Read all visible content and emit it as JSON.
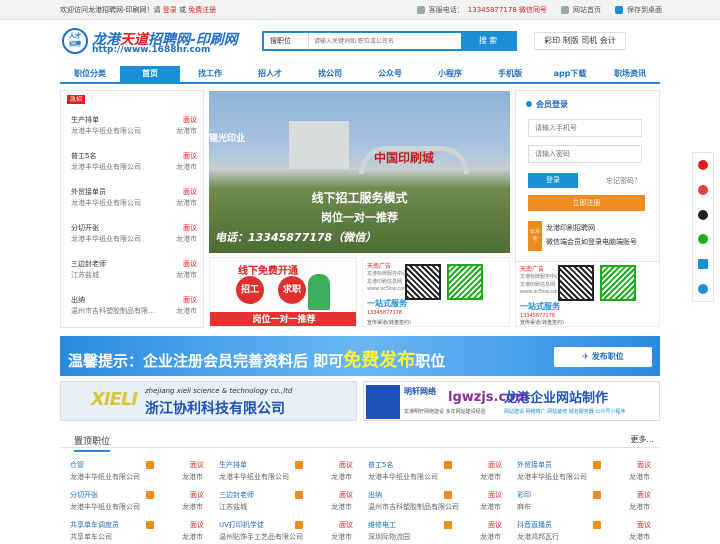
{
  "topbar": {
    "welcome": "欢迎访问龙港招聘网-印刷网！请",
    "login": "登录",
    "or": "或",
    "register": "免费注册",
    "phone_label": "客服电话：",
    "phone": "13345877178 微信同号",
    "mobile_site": "网站首页",
    "save_desktop": "保存到桌面"
  },
  "logo": {
    "badge_top": "人才",
    "badge_bottom": "招聘",
    "title_a": "龙港",
    "title_hl": "天道",
    "title_b": "招聘网-印刷网",
    "url": "http://www.1688hr.com"
  },
  "search": {
    "select": "搜职位",
    "placeholder": "请输入关键词如 职位或公司名",
    "button": "搜 索"
  },
  "hotwords": "彩印 制版 司机 会计",
  "nav": [
    "职位分类",
    "首页",
    "找工作",
    "招人才",
    "找公司",
    "公众号",
    "小程序",
    "手机版",
    "app下载",
    "职场资讯"
  ],
  "joblist": {
    "tag": "急招",
    "rows": [
      {
        "title": "生产排单",
        "salary": "面议",
        "company": "龙港丰华纸业有限公司",
        "loc": "龙港市"
      },
      {
        "title": "普工5名",
        "salary": "面议",
        "company": "龙港丰华纸业有限公司",
        "loc": "龙港市"
      },
      {
        "title": "外贸接单员",
        "salary": "面议",
        "company": "龙港丰华纸业有限公司",
        "loc": "龙港市"
      },
      {
        "title": "分切开张",
        "salary": "面议",
        "company": "龙港丰华纸业有限公司",
        "loc": "龙港市"
      },
      {
        "title": "三边封老师",
        "salary": "面议",
        "company": "江苏盐城",
        "loc": "龙港市"
      },
      {
        "title": "出纳",
        "salary": "面议",
        "company": "温州市吉科塑胶制品有限...",
        "loc": "龙港市"
      }
    ]
  },
  "banner": {
    "sign_left": "锡光印业",
    "gate_text": "中国印刷城",
    "line1": "线下招工服务模式",
    "line2": "岗位一对一推荐",
    "line3": "电话：13345877178（微信）"
  },
  "promo": {
    "title": "线下免费开通",
    "c1": "招工",
    "c2": "求职",
    "bar": "岗位一对一推荐"
  },
  "ads": [
    {
      "head": "天南广告",
      "lines": [
        "龙港标牌服务中心",
        "龙港印刷信息网",
        "www.xc5kw.com",
        "一站式服务"
      ],
      "phone": "13345877178",
      "foot": "宣传渠道(转盘签约)"
    },
    {
      "head": "天南广告",
      "lines": [
        "龙港标牌服务中心",
        "龙港印刷信息网",
        "www.xc5kw.com",
        "一站式服务"
      ],
      "phone": "13345877178",
      "foot": "宣传渠道(转盘签约)"
    }
  ],
  "login": {
    "title": "会员登录",
    "phone_ph": "请输入手机号",
    "pwd_ph": "请输入密码",
    "login_btn": "登录",
    "forget": "忘记密码？",
    "register_btn": "立即注册",
    "wx_tag": "公众号",
    "wx1": "龙港印刷招聘网",
    "wx2": "微信端会员如登录电脑端账号"
  },
  "notice": {
    "prefix": "温馨提示：企业注册会员完善资料后  即可",
    "highlight": "免费发布",
    "suffix": "职位",
    "button": "发布职位"
  },
  "ad2": {
    "logo": "XIELI",
    "en": "zhejiang xieli science & technology co.,ltd",
    "cn": "浙江协利科技有限公司"
  },
  "ad3": {
    "brand": "明轩网络",
    "domain": "lgwzjs.com",
    "cn": "龙港企业网站制作",
    "sub_left": "龙港明轩网络建设  多年网站建设经验",
    "sub_right": "网站建设 网络推广 网站装修 域名服务器 公众号小程序"
  },
  "section": {
    "title": "置顶职位",
    "more": "更多..."
  },
  "grid": [
    [
      {
        "title": "仓管",
        "salary": "面议",
        "company": "龙港丰华纸业有限公司",
        "loc": "龙港市"
      },
      {
        "title": "生产排单",
        "salary": "面议",
        "company": "龙港丰华纸业有限公司",
        "loc": "龙港市"
      },
      {
        "title": "普工5名",
        "salary": "面议",
        "company": "龙港丰华纸业有限公司",
        "loc": "龙港市"
      },
      {
        "title": "外贸接单员",
        "salary": "面议",
        "company": "龙港丰华纸业有限公司",
        "loc": "龙港市"
      }
    ],
    [
      {
        "title": "分切开张",
        "salary": "面议",
        "company": "龙港丰华纸业有限公司",
        "loc": "龙港市"
      },
      {
        "title": "三边封老师",
        "salary": "面议",
        "company": "江苏盐城",
        "loc": "龙港市"
      },
      {
        "title": "出纳",
        "salary": "面议",
        "company": "温州市吉科塑胶制品有限公司",
        "loc": "龙港市"
      },
      {
        "title": "彩印",
        "salary": "面议",
        "company": "麻布",
        "loc": "龙港市"
      }
    ],
    [
      {
        "title": "共享单车调度员",
        "salary": "面议",
        "company": "共享单车公司",
        "loc": "龙港市"
      },
      {
        "title": "UV打印机学徒",
        "salary": "面议",
        "company": "温州贴饰手工艺品有限公司",
        "loc": "龙港市"
      },
      {
        "title": "维修电工",
        "salary": "面议",
        "company": "深圳际物流园",
        "loc": "龙港市"
      },
      {
        "title": "抖音直播员",
        "salary": "面议",
        "company": "龙港鸿邦瓦行",
        "loc": "龙港市"
      }
    ]
  ],
  "colors": {
    "brand": "#1b8fd6",
    "accent": "#e02020",
    "orange": "#f08c1e"
  }
}
